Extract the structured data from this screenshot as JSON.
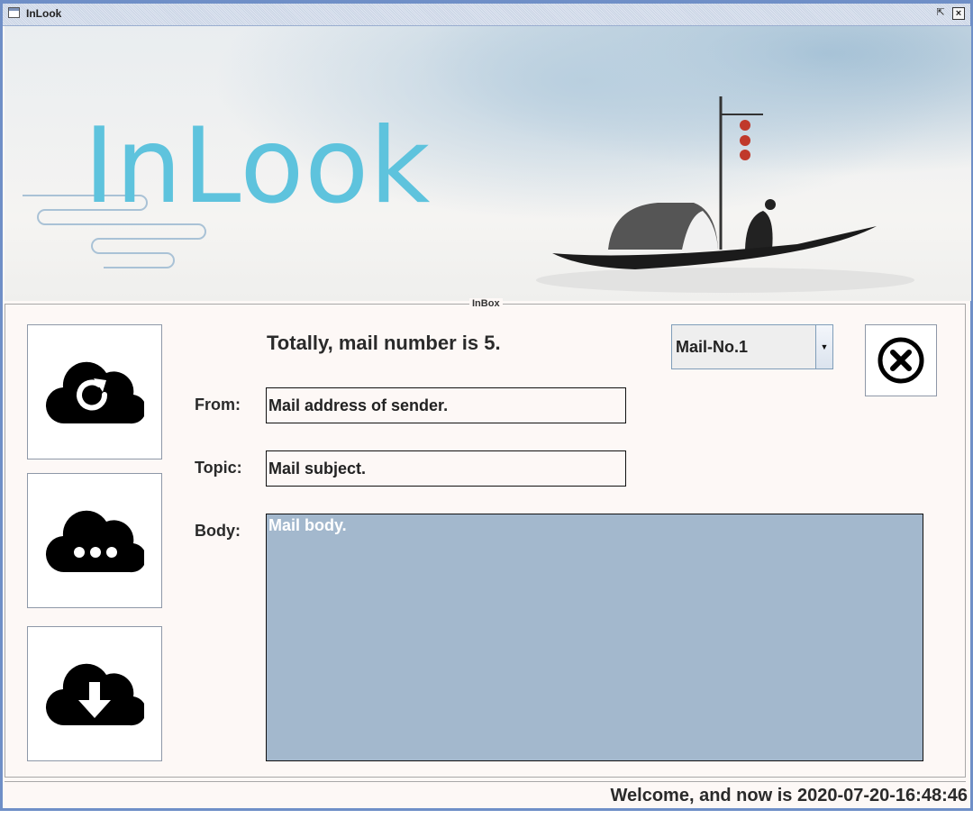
{
  "window": {
    "title": "InLook"
  },
  "banner": {
    "title": "InLook"
  },
  "inbox": {
    "group_title": "InBox",
    "count_text": "Totally, mail number is 5.",
    "mail_select": {
      "selected": "Mail-No.1"
    },
    "from_label": "From:",
    "from_value": "Mail address of sender.",
    "topic_label": "Topic:",
    "topic_value": "Mail subject.",
    "body_label": "Body:",
    "body_value": "Mail body."
  },
  "side_buttons": [
    {
      "icon": "cloud-refresh-icon"
    },
    {
      "icon": "cloud-more-icon"
    },
    {
      "icon": "cloud-download-icon"
    }
  ],
  "status": {
    "text": "Welcome, and now is 2020-07-20-16:48:46"
  },
  "colors": {
    "accent": "#5ec3dd",
    "body_bg": "#a3b8cd",
    "window_border": "#6f8fc7"
  }
}
